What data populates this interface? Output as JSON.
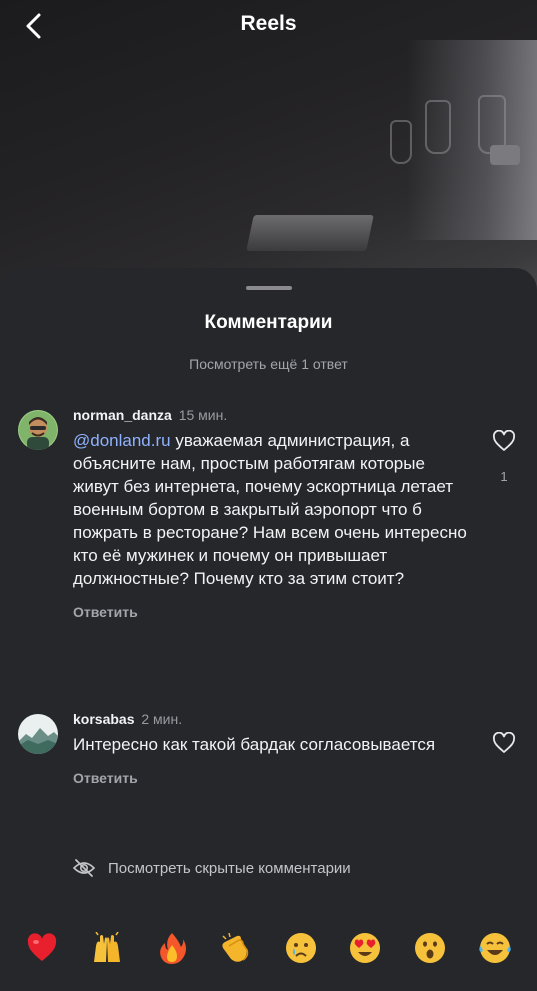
{
  "header": {
    "title": "Reels",
    "back_icon": "chevron-left-icon"
  },
  "sheet": {
    "title": "Комментарии",
    "more_replies": "Посмотреть ещё 1 ответ",
    "hidden_comments": "Посмотреть скрытые комментарии",
    "hidden_icon": "eye-slash-icon"
  },
  "comments": [
    {
      "username": "norman_danza",
      "time": "15 мин.",
      "mention": "@donland.ru",
      "text": " уважаемая администрация, а объясните нам, простым работягам которые живут без интернета, почему эскортница летает военным бортом в закрытый аэропорт что б пожрать в ресторане? Нам всем очень интересно кто её мужинек и почему он привышает должностные? Почему кто за этим стоит?",
      "reply": "Ответить",
      "likes": "1"
    },
    {
      "username": "korsabas",
      "time": "2 мин.",
      "mention": "",
      "text": "Интересно как такой бардак согласовывается",
      "reply": "Ответить",
      "likes": ""
    }
  ],
  "emoji_bar": [
    {
      "name": "red-heart",
      "glyph": "❤️"
    },
    {
      "name": "raising-hands",
      "glyph": "🙌"
    },
    {
      "name": "fire",
      "glyph": "🔥"
    },
    {
      "name": "clapping-hands",
      "glyph": "👏"
    },
    {
      "name": "crying-face",
      "glyph": "😢"
    },
    {
      "name": "heart-eyes",
      "glyph": "😍"
    },
    {
      "name": "surprised-face",
      "glyph": "😮"
    },
    {
      "name": "tears-of-joy",
      "glyph": "😂"
    }
  ],
  "colors": {
    "sheet_bg": "#26272b",
    "mention": "#8fb2ff",
    "secondary_text": "#a4a4aa"
  }
}
